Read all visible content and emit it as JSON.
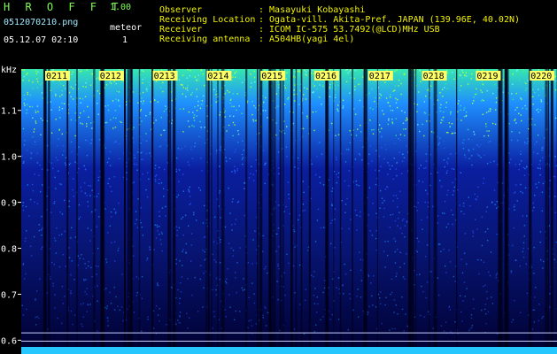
{
  "header": {
    "brand": "H R O F F T",
    "version": "1.00",
    "filename": "0512070210.png",
    "datetime": "05.12.07 02:10",
    "meteor_label": "meteor",
    "meteor_count": "1"
  },
  "info": {
    "observer_label": "Observer",
    "observer_value": ": Masayuki Kobayashi",
    "location_label": "Receiving Location",
    "location_value": ": Ogata-vill. Akita-Pref. JAPAN (139.96E, 40.02N)",
    "receiver_label": "Receiver",
    "receiver_value": ": ICOM IC-575 53.7492(@LCD)MHz USB",
    "antenna_label": "Receiving antenna",
    "antenna_value": ": A504HB(yagi 4el)"
  },
  "spectrogram": {
    "unit_label": "kHz",
    "y_ticks": [
      "1.1",
      "1.0",
      "0.9",
      "0.8",
      "0.7",
      "0.6"
    ],
    "y_tick_values": [
      1.1,
      1.0,
      0.9,
      0.8,
      0.7,
      0.6
    ],
    "ylim": [
      0.57,
      1.19
    ],
    "minute_labels": [
      "0211",
      "0212",
      "0213",
      "0214",
      "0215",
      "0216",
      "0217",
      "0218",
      "0219",
      "0220"
    ],
    "colors": {
      "background": "#000030",
      "low": "#0a1fa0",
      "mid": "#1f8fff",
      "high": "#35e6b0",
      "peak": "#a8ff40",
      "label_bg": "#ffff66"
    }
  }
}
